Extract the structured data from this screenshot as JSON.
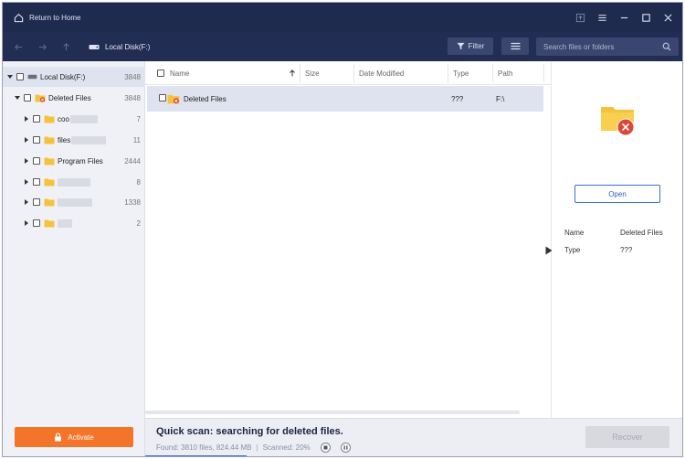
{
  "titlebar": {
    "home_label": "Return to Home"
  },
  "toolbar": {
    "location": "Local Disk(F:)",
    "filter_label": "Filter",
    "search_placeholder": "Search files or folders"
  },
  "tree": {
    "root": {
      "label": "Local Disk(F:)",
      "count": "3848"
    },
    "deleted": {
      "label": "Deleted Files",
      "count": "3848"
    },
    "items": [
      {
        "label": "coo",
        "count": "7"
      },
      {
        "label": "files",
        "count": "11"
      },
      {
        "label": "Program Files",
        "count": "2444"
      },
      {
        "label": "",
        "count": "8"
      },
      {
        "label": "",
        "count": "1338"
      },
      {
        "label": "",
        "count": "2"
      }
    ]
  },
  "activate_label": "Activate",
  "columns": {
    "name": "Name",
    "size": "Size",
    "date": "Date Modified",
    "type": "Type",
    "path": "Path"
  },
  "rows": [
    {
      "name": "Deleted Files",
      "size": "",
      "date": "",
      "type": "???",
      "path": "F:\\"
    }
  ],
  "preview": {
    "open_label": "Open",
    "name_key": "Name",
    "name_value": "Deleted Files",
    "type_key": "Type",
    "type_value": "???"
  },
  "status": {
    "title": "Quick scan: searching for deleted files.",
    "found": "Found: 3810 files, 824.44 MB",
    "scanned": "Scanned: 20%",
    "scan_progress": 0.2,
    "recover_label": "Recover"
  },
  "colors": {
    "accent": "#3b6fd0",
    "activate": "#f4752a",
    "titlebar": "#1f2a4f",
    "delete_badge": "#e0453a"
  }
}
